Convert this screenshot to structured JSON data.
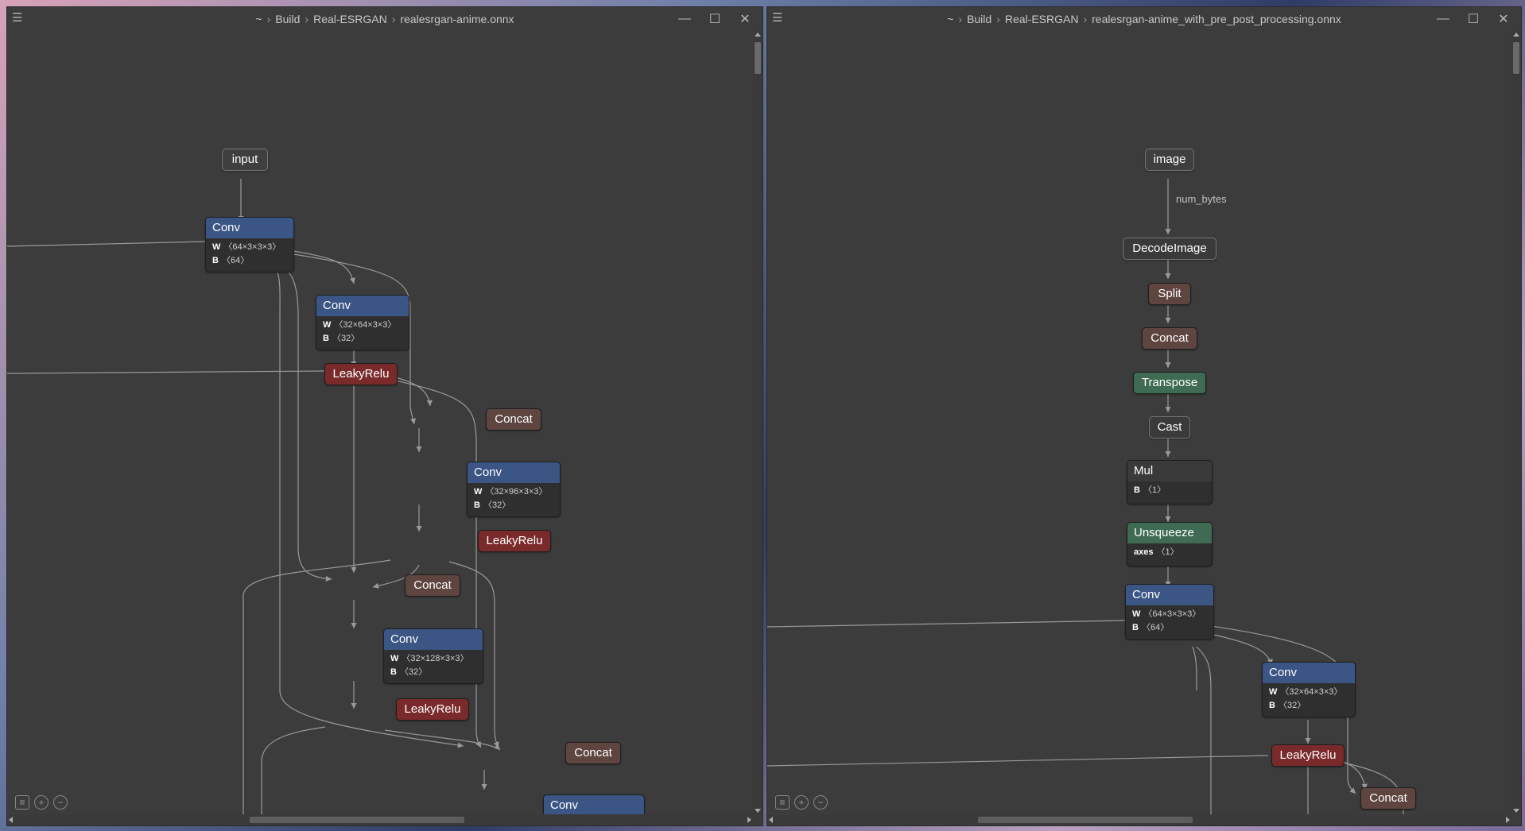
{
  "colors": {
    "window_bg": "#3c3c3c",
    "conv": "#3b5585",
    "activation": "#7a2a2a",
    "concat": "#5e4540",
    "io": "#3f3f3f",
    "transform": "#3f6b52",
    "edge": "#9a9a9a"
  },
  "left": {
    "breadcrumb": [
      "~",
      "Build",
      "Real-ESRGAN",
      "realesrgan-anime.onnx"
    ],
    "nodes": {
      "input": {
        "label": "input"
      },
      "conv1": {
        "label": "Conv",
        "W": "〈64×3×3×3〉",
        "B": "〈64〉"
      },
      "conv2": {
        "label": "Conv",
        "W": "〈32×64×3×3〉",
        "B": "〈32〉"
      },
      "leaky1": {
        "label": "LeakyRelu"
      },
      "concat1": {
        "label": "Concat"
      },
      "conv3": {
        "label": "Conv",
        "W": "〈32×96×3×3〉",
        "B": "〈32〉"
      },
      "leaky2": {
        "label": "LeakyRelu"
      },
      "concat2": {
        "label": "Concat"
      },
      "conv4": {
        "label": "Conv",
        "W": "〈32×128×3×3〉",
        "B": "〈32〉"
      },
      "leaky3": {
        "label": "LeakyRelu"
      },
      "concat3": {
        "label": "Concat"
      },
      "conv5": {
        "label": "Conv"
      }
    }
  },
  "right": {
    "breadcrumb": [
      "~",
      "Build",
      "Real-ESRGAN",
      "realesrgan-anime_with_pre_post_processing.onnx"
    ],
    "edge_label": "num_bytes",
    "nodes": {
      "image": {
        "label": "image"
      },
      "decode": {
        "label": "DecodeImage"
      },
      "split": {
        "label": "Split"
      },
      "concat0": {
        "label": "Concat"
      },
      "transpose": {
        "label": "Transpose"
      },
      "cast": {
        "label": "Cast"
      },
      "mul": {
        "label": "Mul",
        "B": "〈1〉"
      },
      "unsqueeze": {
        "label": "Unsqueeze",
        "axes": "〈1〉"
      },
      "conv1": {
        "label": "Conv",
        "W": "〈64×3×3×3〉",
        "B": "〈64〉"
      },
      "conv2": {
        "label": "Conv",
        "W": "〈32×64×3×3〉",
        "B": "〈32〉"
      },
      "leaky1": {
        "label": "LeakyRelu"
      },
      "concat1": {
        "label": "Concat"
      }
    }
  },
  "icons": {
    "menu": "hamburger-icon",
    "minimize": "minimize-icon",
    "maximize": "maximize-icon",
    "close": "close-icon",
    "list": "list-icon",
    "zoom_in": "zoom-in-icon",
    "zoom_out": "zoom-out-icon"
  },
  "attr_names": {
    "W": "W",
    "B": "B",
    "axes": "axes"
  },
  "window_glyphs": {
    "menu": "☰",
    "minimize": "—",
    "maximize": "☐",
    "close": "✕",
    "zoom_in": "+",
    "zoom_out": "−"
  }
}
